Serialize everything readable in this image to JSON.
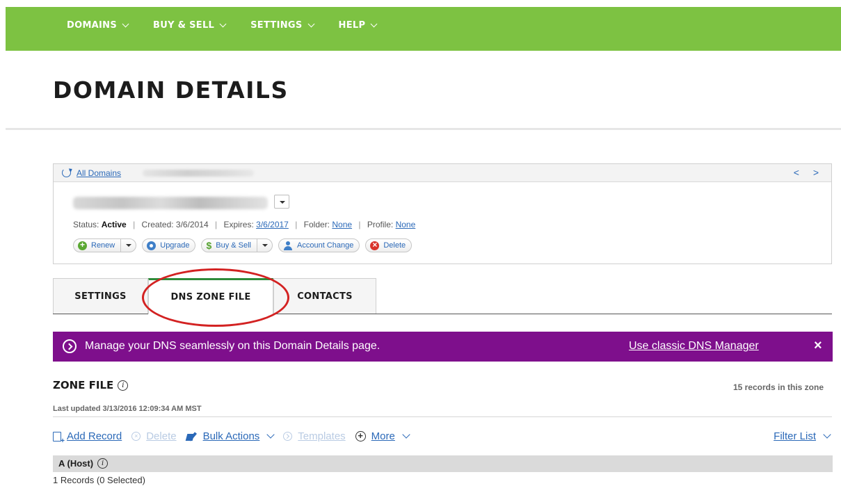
{
  "nav": {
    "items": [
      {
        "label": "DOMAINS"
      },
      {
        "label": "BUY & SELL"
      },
      {
        "label": "SETTINGS"
      },
      {
        "label": "HELP"
      }
    ]
  },
  "page": {
    "title": "DOMAIN DETAILS"
  },
  "domain_panel": {
    "all_domains_link": "All Domains",
    "nav_arrows": "< >",
    "status_label": "Status:",
    "status_value": "Active",
    "created_label": "Created: 3/6/2014",
    "expires_label": "Expires:",
    "expires_value": "3/6/2017",
    "folder_label": "Folder:",
    "folder_value": "None",
    "profile_label": "Profile:",
    "profile_value": "None",
    "actions": {
      "renew": "Renew",
      "upgrade": "Upgrade",
      "buy_sell": "Buy & Sell",
      "account_change": "Account Change",
      "delete": "Delete"
    }
  },
  "tabs": [
    {
      "label": "SETTINGS"
    },
    {
      "label": "DNS ZONE FILE"
    },
    {
      "label": "CONTACTS"
    }
  ],
  "banner": {
    "text": "Manage your DNS seamlessly on this Domain Details page.",
    "link": "Use classic DNS Manager",
    "close": "×"
  },
  "zone": {
    "title": "ZONE FILE",
    "records_count": "15 records in this zone",
    "last_updated": "Last updated 3/13/2016 12:09:34 AM MST",
    "toolbar": {
      "add_record": "Add Record",
      "delete": "Delete",
      "bulk_actions": "Bulk Actions",
      "templates": "Templates",
      "more": "More",
      "filter_list": "Filter List"
    },
    "host_section": "A (Host)",
    "records_selected": "1 Records (0 Selected)"
  },
  "colors": {
    "nav_green": "#7dc242",
    "banner_purple": "#7e0f8c",
    "link_blue": "#2b69b8",
    "annotation_red": "#d32222"
  }
}
